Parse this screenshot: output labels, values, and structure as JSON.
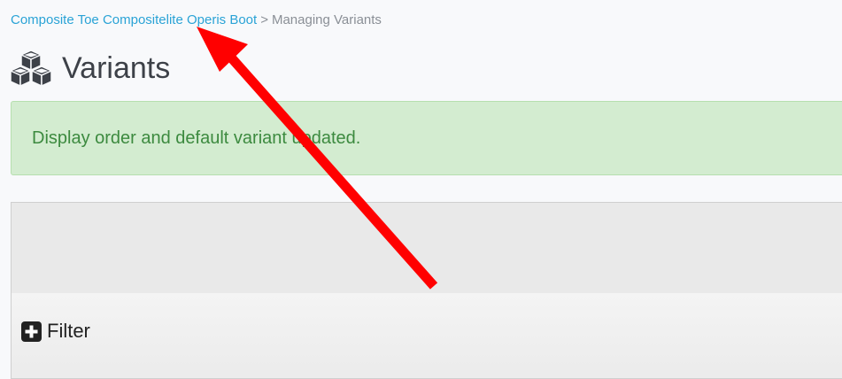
{
  "breadcrumb": {
    "product_link": "Composite Toe Compositelite Operis Boot",
    "separator": ">",
    "current": "Managing Variants"
  },
  "page": {
    "title": "Variants",
    "title_icon": "cubes-icon"
  },
  "alert": {
    "message": "Display order and default variant updated.",
    "type": "success"
  },
  "filter": {
    "label": "Filter",
    "icon": "plus-square-icon"
  },
  "annotation": {
    "icon": "red-arrow-annotation"
  },
  "colors": {
    "link": "#2aa3d6",
    "success_bg": "#d3ecd0",
    "success_text": "#3c8a3f",
    "arrow": "#ff0000"
  }
}
